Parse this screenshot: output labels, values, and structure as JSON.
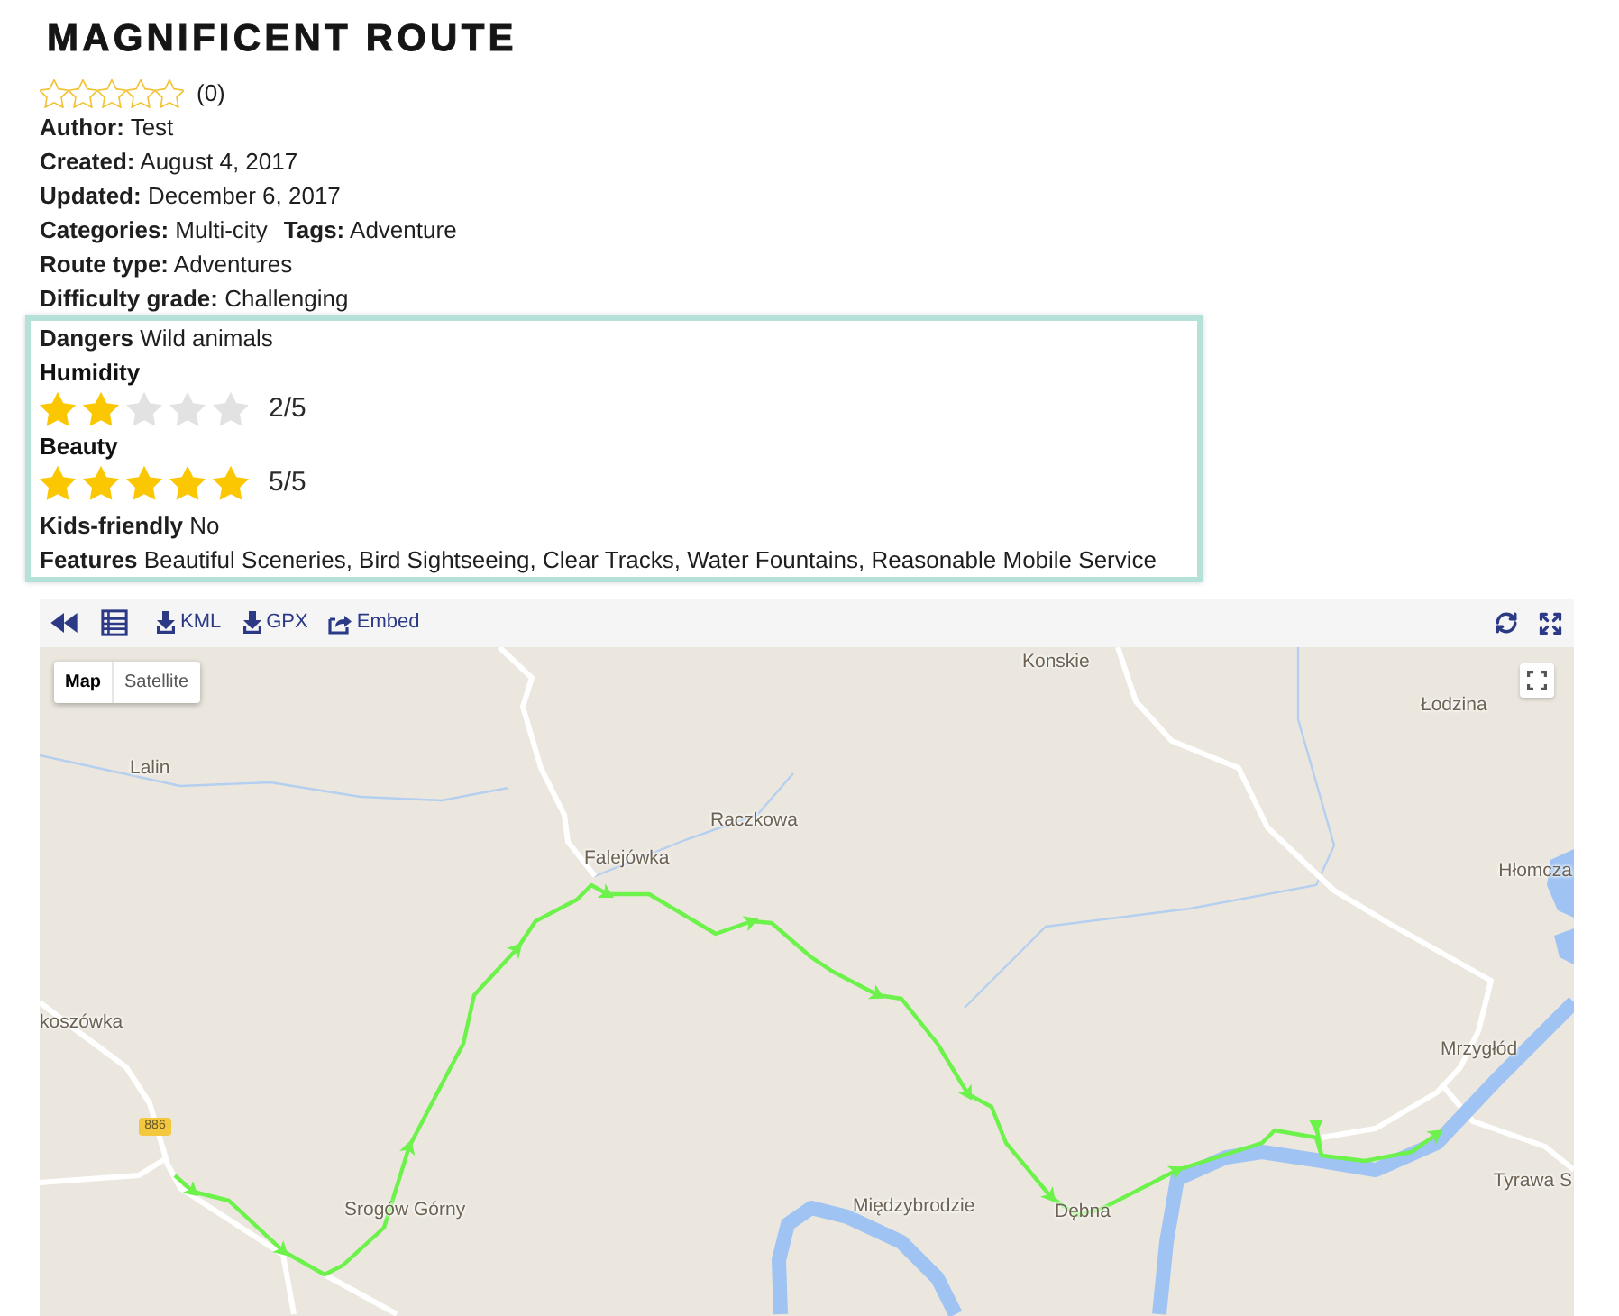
{
  "title": "MAGNIFICENT ROUTE",
  "rating": {
    "stars": 0,
    "count": "(0)"
  },
  "meta": [
    [
      "**Author:** Test"
    ],
    [
      "**Created:** August 4, 2017"
    ],
    [
      "**Updated:** December 6, 2017"
    ],
    [
      "**Categories:** Multi-city",
      "**Tags:** Adventure"
    ],
    [
      "**Route type:** Adventures"
    ],
    [
      "**Difficulty grade:** Challenging"
    ]
  ],
  "details": [
    {
      "kind": "text",
      "text": "**Dangers** Wild animals"
    },
    {
      "kind": "heading",
      "text": "Humidity"
    },
    {
      "kind": "rating",
      "stars": 2,
      "reading": "2/5"
    },
    {
      "kind": "heading",
      "text": "Beauty"
    },
    {
      "kind": "rating",
      "stars": 5,
      "reading": "5/5"
    },
    {
      "kind": "text",
      "text": "**Kids-friendly** No"
    },
    {
      "kind": "text",
      "text": "**Features** Beautiful Sceneries, Bird Sightseeing, Clear Tracks, Water Fountains, Reasonable Mobile Service"
    }
  ],
  "toolbar": {
    "left": [
      {
        "kind": "rewind"
      },
      {
        "kind": "list"
      },
      {
        "kind": "download",
        "label": "KML"
      },
      {
        "kind": "download",
        "label": "GPX"
      },
      {
        "kind": "share",
        "label": "Embed"
      }
    ],
    "right": [
      {
        "kind": "refresh"
      },
      {
        "kind": "expand"
      }
    ]
  },
  "map": {
    "type_control": [
      {
        "label": "Map",
        "selected": true
      },
      {
        "label": "Satellite",
        "selected": false
      }
    ],
    "place_labels": [
      "Konskie",
      "Łodzina",
      "Lalin",
      "Raczkowa",
      "Falejówka",
      "Hłomcza",
      "koszówka",
      "Srogów Górny",
      "Międzybrodzie",
      "Dębna",
      "Mrzygłód",
      "Tyrawa S"
    ],
    "road_sign": "886"
  }
}
